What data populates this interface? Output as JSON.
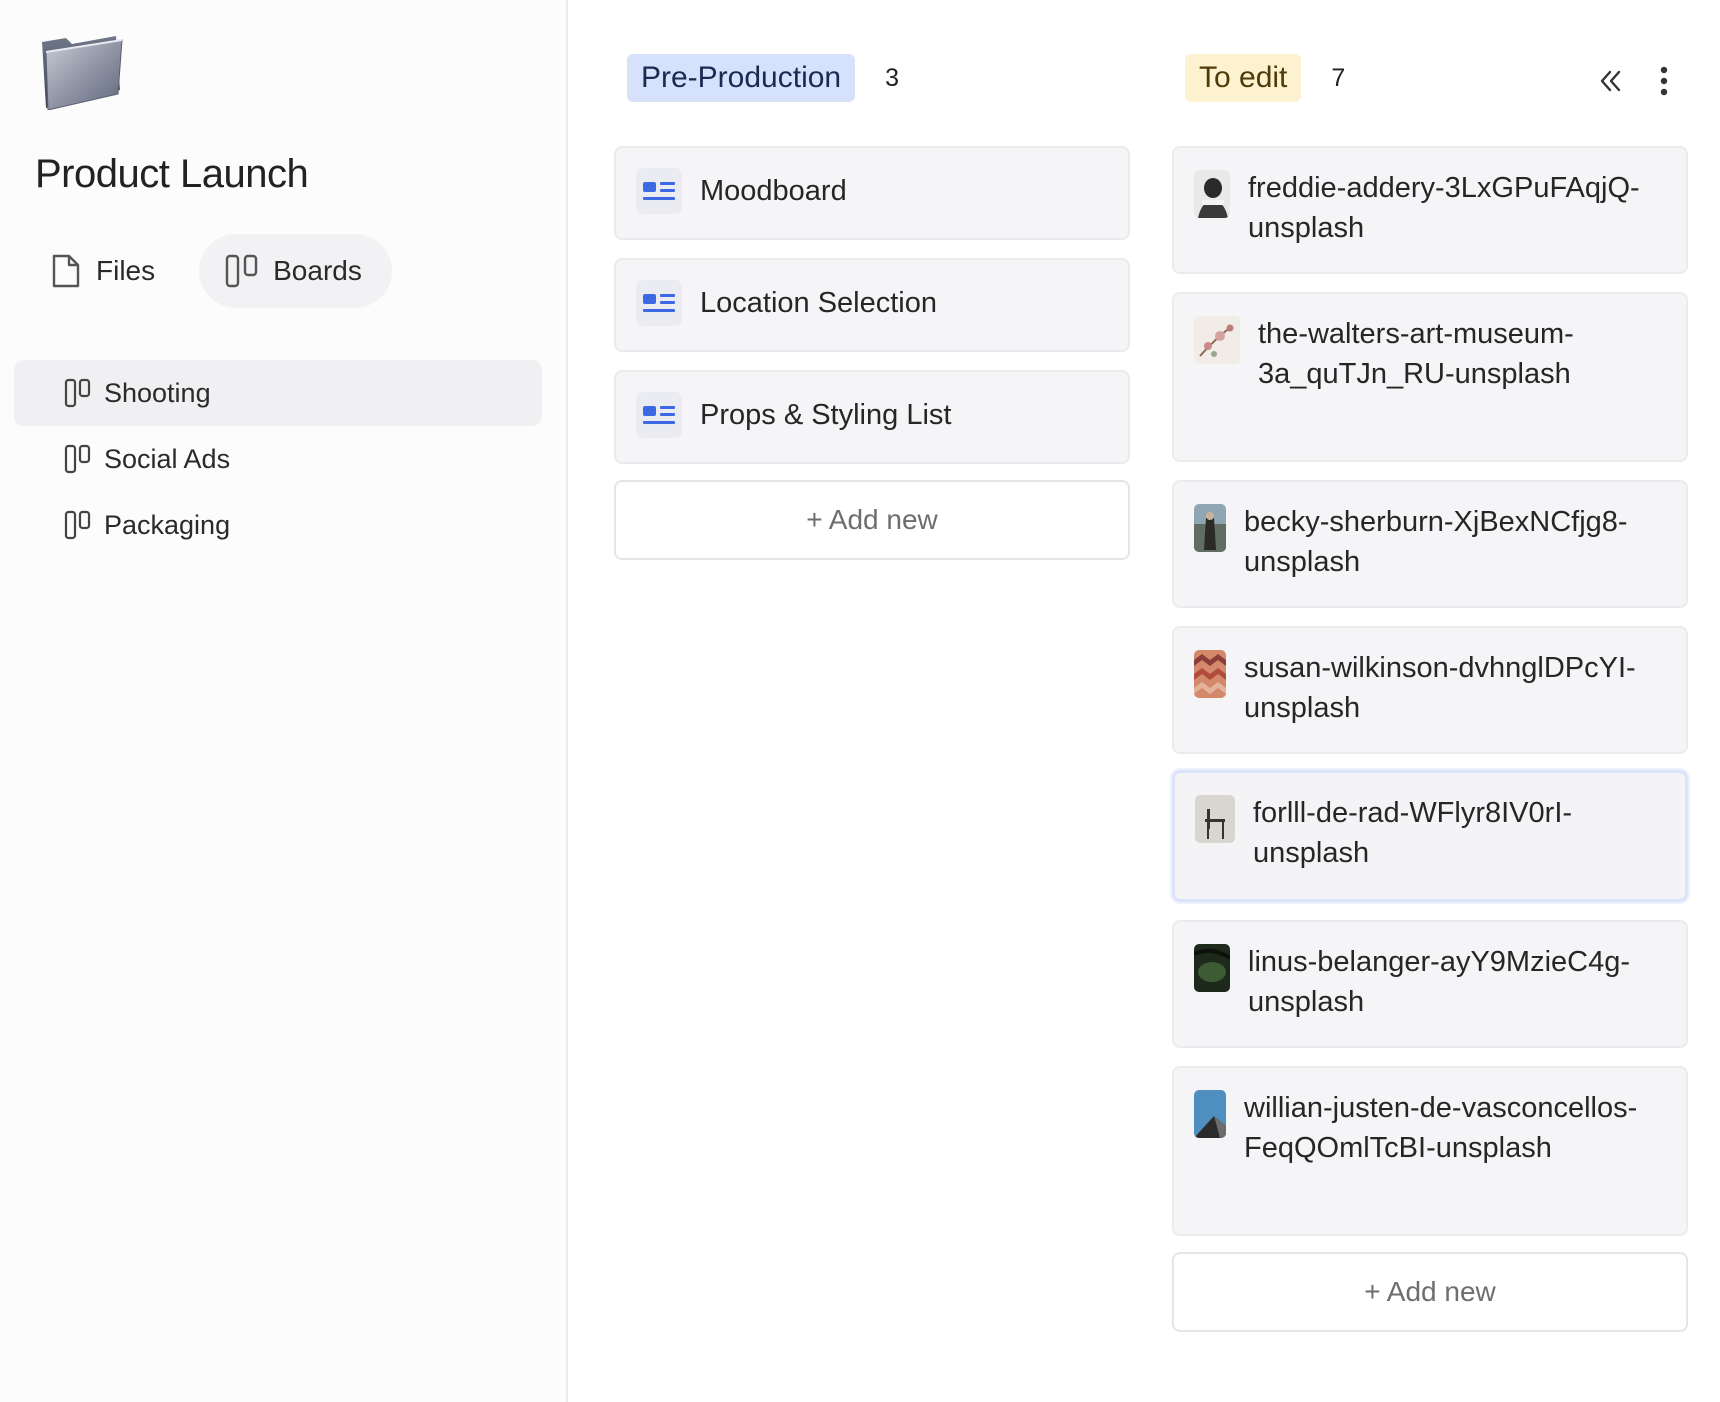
{
  "sidebar": {
    "project_title": "Product Launch",
    "modes": [
      {
        "label": "Files",
        "icon": "file-icon"
      },
      {
        "label": "Boards",
        "icon": "board-icon"
      }
    ],
    "boards": [
      {
        "label": "Shooting",
        "icon": "board-icon"
      },
      {
        "label": "Social Ads",
        "icon": "board-icon"
      },
      {
        "label": "Packaging",
        "icon": "board-icon"
      }
    ]
  },
  "columns": [
    {
      "title": "Pre-Production",
      "count": "3",
      "color": "#d6e2fb",
      "cards": [
        {
          "title": "Moodboard",
          "icon": "document-icon"
        },
        {
          "title": "Location Selection",
          "icon": "document-icon"
        },
        {
          "title": "Props & Styling List",
          "icon": "document-icon"
        }
      ],
      "add_label": "+ Add new"
    },
    {
      "title": "To edit",
      "count": "7",
      "color": "#fdf2cf",
      "cards": [
        {
          "title": "freddie-addery-3LxGPuFAqjQ-unsplash"
        },
        {
          "title": "the-walters-art-museum-3a_quTJn_RU-unsplash"
        },
        {
          "title": "becky-sherburn-XjBexNCfjg8-unsplash"
        },
        {
          "title": "susan-wilkinson-dvhnglDPcYI-unsplash"
        },
        {
          "title": "forlll-de-rad-WFlyr8IV0rI-unsplash"
        },
        {
          "title": "linus-belanger-ayY9MzieC4g-unsplash"
        },
        {
          "title": "willian-justen-de-vasconcellos-FeqQOmlTcBI-unsplash"
        }
      ],
      "add_label": "+ Add new"
    }
  ],
  "toolbar": {
    "collapse_icon": "double-chevron-left-icon",
    "more_icon": "vertical-dots-icon"
  }
}
